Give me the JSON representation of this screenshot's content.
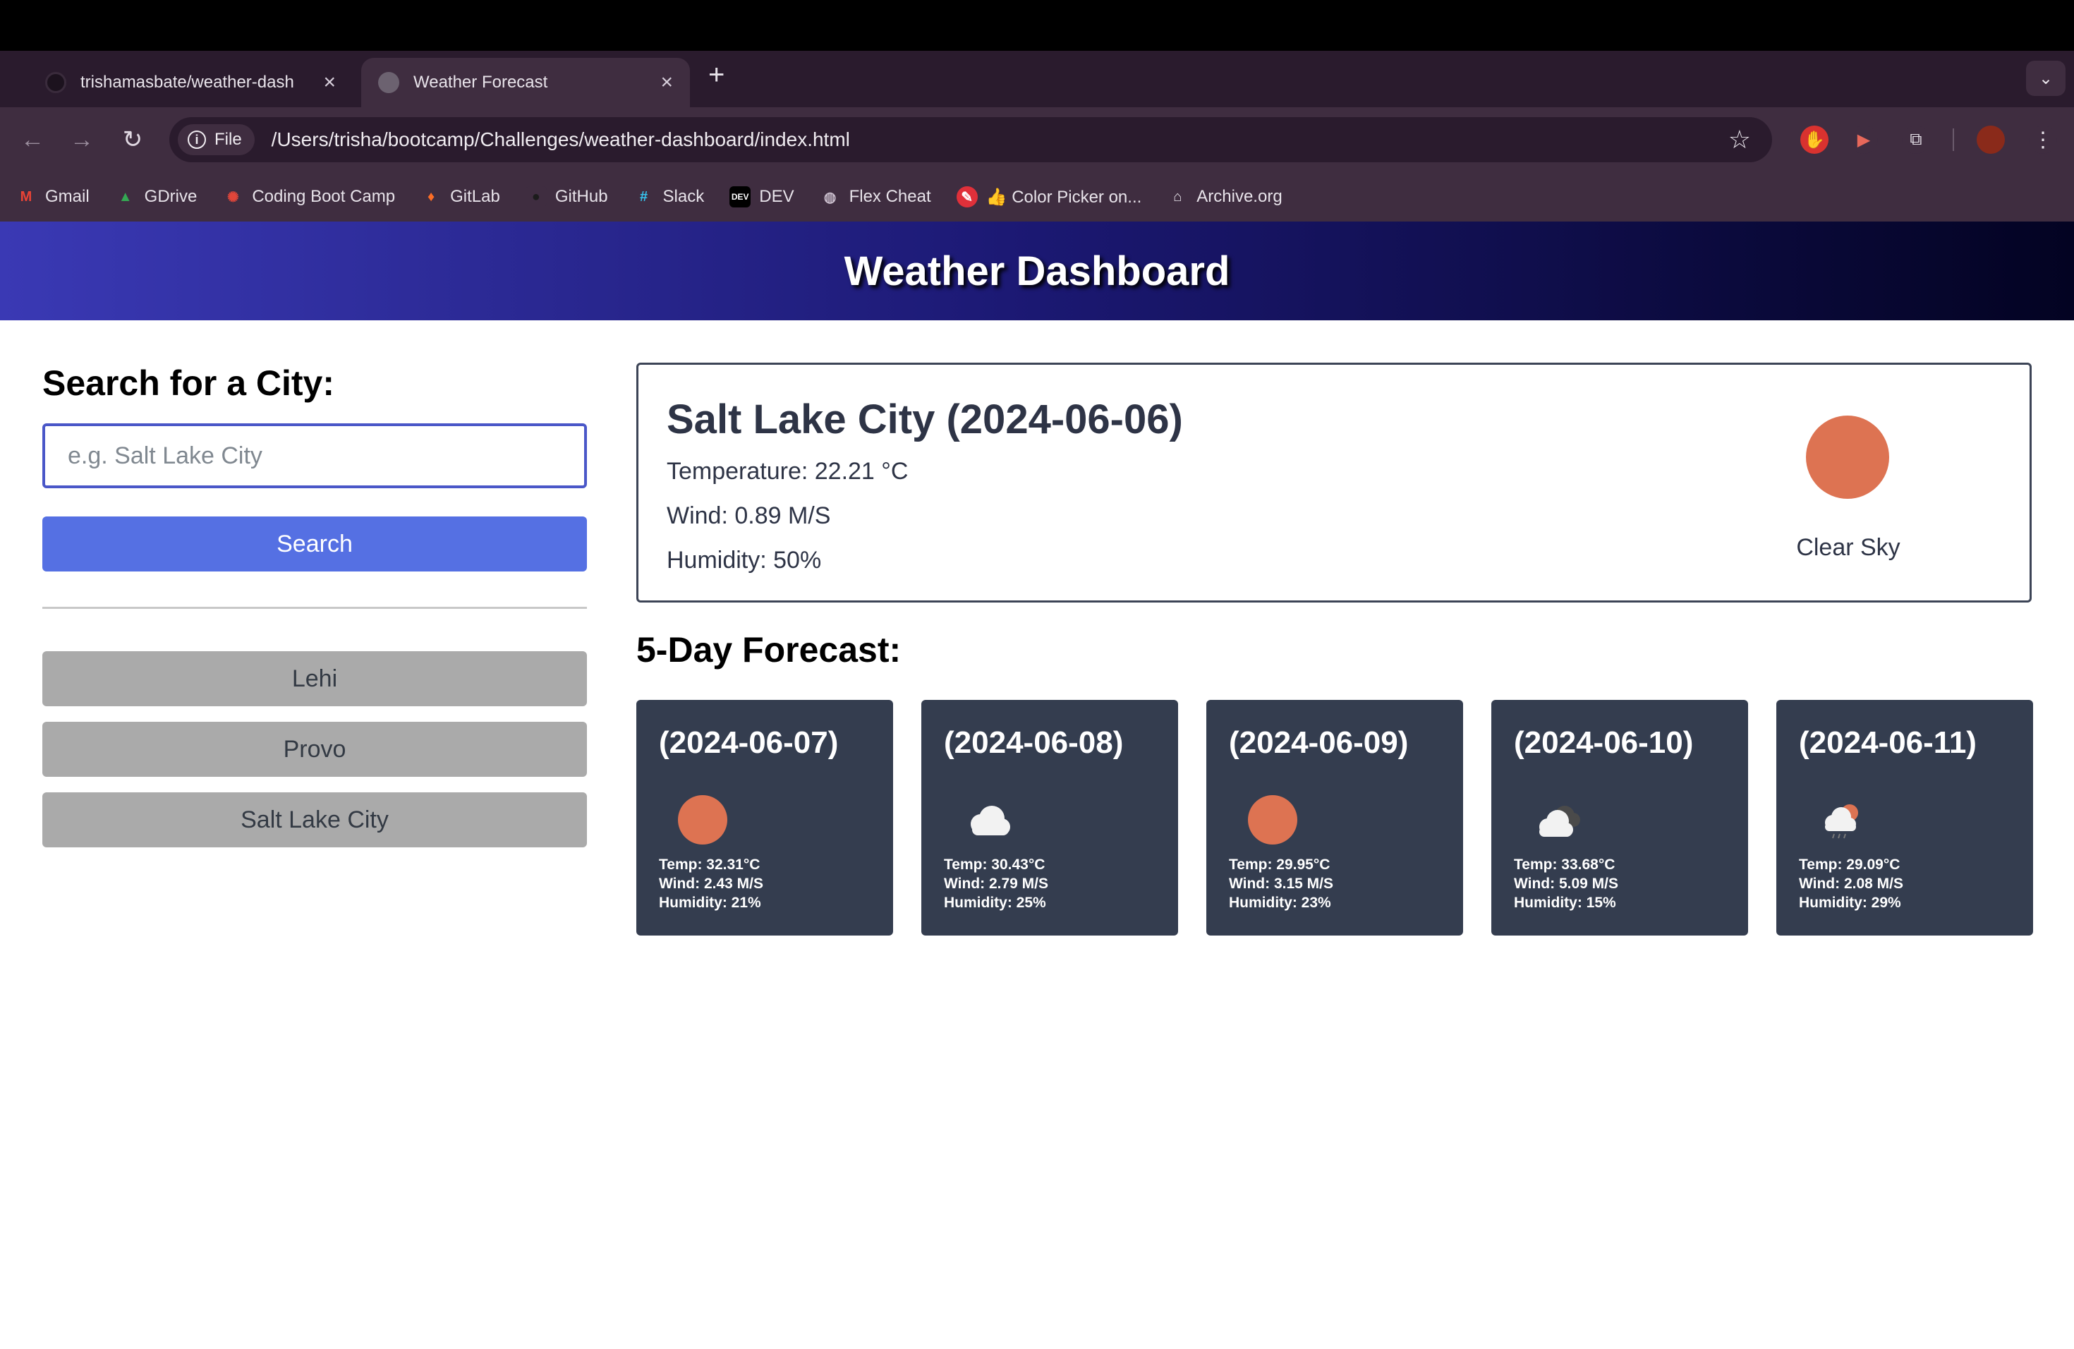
{
  "browser": {
    "tabs": [
      {
        "title": "trishamasbate/weather-dash",
        "active": false
      },
      {
        "title": "Weather Forecast",
        "active": true
      }
    ],
    "new_tab": "+",
    "tab_close": "×",
    "address": {
      "scheme_chip": "File",
      "url": "/Users/trisha/bootcamp/Challenges/weather-dashboard/index.html"
    },
    "bookmarks": [
      {
        "label": "Gmail",
        "icon": "gmail-icon",
        "glyph": "M",
        "color": "#ea4335"
      },
      {
        "label": "GDrive",
        "icon": "gdrive-icon",
        "glyph": "▲",
        "color": "#34a853"
      },
      {
        "label": "Coding Boot Camp",
        "icon": "bootcamp-icon",
        "glyph": "✺",
        "color": "#e2463a"
      },
      {
        "label": "GitLab",
        "icon": "gitlab-icon",
        "glyph": "♦",
        "color": "#fc6d26"
      },
      {
        "label": "GitHub",
        "icon": "github-icon",
        "glyph": "●",
        "color": "#1c1c1c"
      },
      {
        "label": "Slack",
        "icon": "slack-icon",
        "glyph": "#",
        "color": "#36c5f0"
      },
      {
        "label": "DEV",
        "icon": "dev-icon",
        "glyph": "DEV",
        "color": "#000000"
      },
      {
        "label": "Flex Cheat",
        "icon": "globe-icon",
        "glyph": "◍",
        "color": "#9c8fa0"
      },
      {
        "label": "👍 Color Picker on...",
        "icon": "color-picker-icon",
        "glyph": "✎",
        "color": "#e0303a"
      },
      {
        "label": "Archive.org",
        "icon": "archive-icon",
        "glyph": "🏛",
        "color": "#e8e3ea"
      }
    ]
  },
  "page": {
    "title": "Weather Dashboard",
    "search": {
      "heading": "Search for a City:",
      "placeholder": "e.g. Salt Lake City",
      "button": "Search"
    },
    "history": [
      "Lehi",
      "Provo",
      "Salt Lake City"
    ],
    "current": {
      "heading": "Salt Lake City (2024-06-06)",
      "temperature": "Temperature: 22.21 °C",
      "wind": "Wind: 0.89 M/S",
      "humidity": "Humidity: 50%",
      "icon": "sun-icon",
      "description": "Clear Sky"
    },
    "forecast_title": "5-Day Forecast:",
    "forecast": [
      {
        "date": "(2024-06-07)",
        "icon": "sun-icon",
        "temp": "Temp: 32.31°C",
        "wind": "Wind: 2.43 M/S",
        "humidity": "Humidity: 21%"
      },
      {
        "date": "(2024-06-08)",
        "icon": "cloud-icon",
        "temp": "Temp: 30.43°C",
        "wind": "Wind: 2.79 M/S",
        "humidity": "Humidity: 25%"
      },
      {
        "date": "(2024-06-09)",
        "icon": "sun-icon",
        "temp": "Temp: 29.95°C",
        "wind": "Wind: 3.15 M/S",
        "humidity": "Humidity: 23%"
      },
      {
        "date": "(2024-06-10)",
        "icon": "broken-clouds-icon",
        "temp": "Temp: 33.68°C",
        "wind": "Wind: 5.09 M/S",
        "humidity": "Humidity: 15%"
      },
      {
        "date": "(2024-06-11)",
        "icon": "rain-icon",
        "temp": "Temp: 29.09°C",
        "wind": "Wind: 2.08 M/S",
        "humidity": "Humidity: 29%"
      }
    ],
    "colors": {
      "accent": "#5570e3",
      "card": "#343d4f",
      "sun": "#dd7352"
    }
  }
}
